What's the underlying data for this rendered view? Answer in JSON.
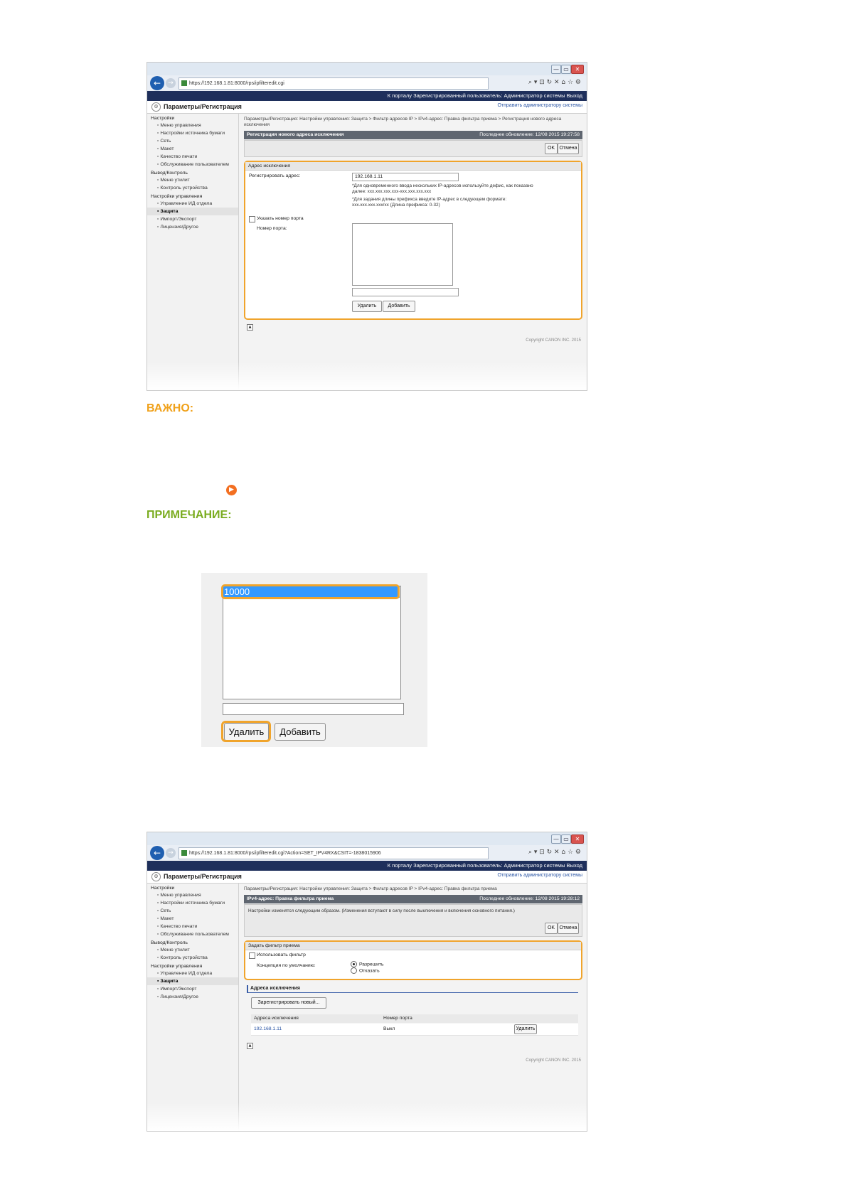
{
  "common": {
    "portal_bar": "К порталу   Зарегистрированный пользователь: Администратор системы  Выход",
    "page_title": "Параметры/Регистрация",
    "send_link": "Отправить администратору системы",
    "copyright": "Copyright CANON INC. 2015",
    "window_buttons": [
      "—",
      "▭",
      "✕"
    ],
    "nav_icons": "⌕ ▾ ⊡ ↻ ✕    ⌂ ☆ ⚙",
    "sidebar": {
      "settings_header": "Настройки",
      "settings_items": [
        "Меню управления",
        "Настройки источника бумаги",
        "Сеть",
        "Макет",
        "Качество печати",
        "Обслуживание пользователем"
      ],
      "output_header": "Вывод/Контроль",
      "output_items": [
        "Меню утилит",
        "Контроль устройства"
      ],
      "mgmt_header": "Настройки управления",
      "mgmt_items": [
        "Управление ИД отдела",
        "Защита",
        "Импорт/Экспорт",
        "Лицензия/Другое"
      ]
    }
  },
  "screenshot1": {
    "url": "https://192.168.1.81:8000/rps/ipfilteredit.cgi",
    "breadcrumb": "Параметры/Регистрация: Настройки управления: Защита > Фильтр адресов IP > IPv4-адрес: Правка фильтра приема > Регистрация нового адреса исключения",
    "section_title": "Регистрация нового адреса исключения",
    "last_update": "Последнее обновление: 12/08 2015 19:27:58",
    "ok_label": "OK",
    "cancel_label": "Отмена",
    "box_title": "Адрес исключения",
    "register_label": "Регистрировать адрес:",
    "address_value": "192.168.1.11",
    "hint1": "*Для одновременного ввода нескольких IP-адресов используйте дефис, как показано далее: xxx.xxx.xxx.xxx-xxx.xxx.xxx.xxx",
    "hint2": "*Для задания длины префикса введите IP-адрес в следующем формате: xxx.xxx.xxx.xxx/xx (Длина префикса: 0-32)",
    "port_checkbox": "Указать номер порта",
    "port_label": "Номер порта:",
    "delete_label": "Удалить",
    "add_label": "Добавить"
  },
  "important_label": "ВАЖНО:",
  "note_label": "ПРИМЕЧАНИЕ:",
  "zoom": {
    "selected_port": "10000",
    "delete_label": "Удалить",
    "add_label": "Добавить"
  },
  "screenshot2": {
    "url": "https://192.168.1.81:8000/rps/ipfilteredit.cgi?Action=SET_IPV4RX&CSIT=-1838015906",
    "breadcrumb": "Параметры/Регистрация: Настройки управления: Защита > Фильтр адресов IP > IPv4-адрес: Правка фильтра приема",
    "section_title": "IPv4-адрес: Правка фильтра приема",
    "last_update": "Последнее обновление: 12/08 2015 19:28:12",
    "message": "Настройки изменятся следующим образом. (Изменения вступают в силу после выключения и включения основного питания.)",
    "ok_label": "OK",
    "cancel_label": "Отмена",
    "box_title": "Задать фильтр приема",
    "use_filter": "Использовать фильтр",
    "default_policy_label": "Концепция по умолчанию:",
    "allow": "Разрешить",
    "deny": "Отказать",
    "exceptions_header": "Адреса исключения",
    "register_new": "Зарегистрировать новый...",
    "col_address": "Адреса исключения",
    "col_port": "Номер порта",
    "rows": [
      {
        "address": "192.168.1.11",
        "port": "Выкл",
        "action": "Удалить"
      }
    ]
  }
}
